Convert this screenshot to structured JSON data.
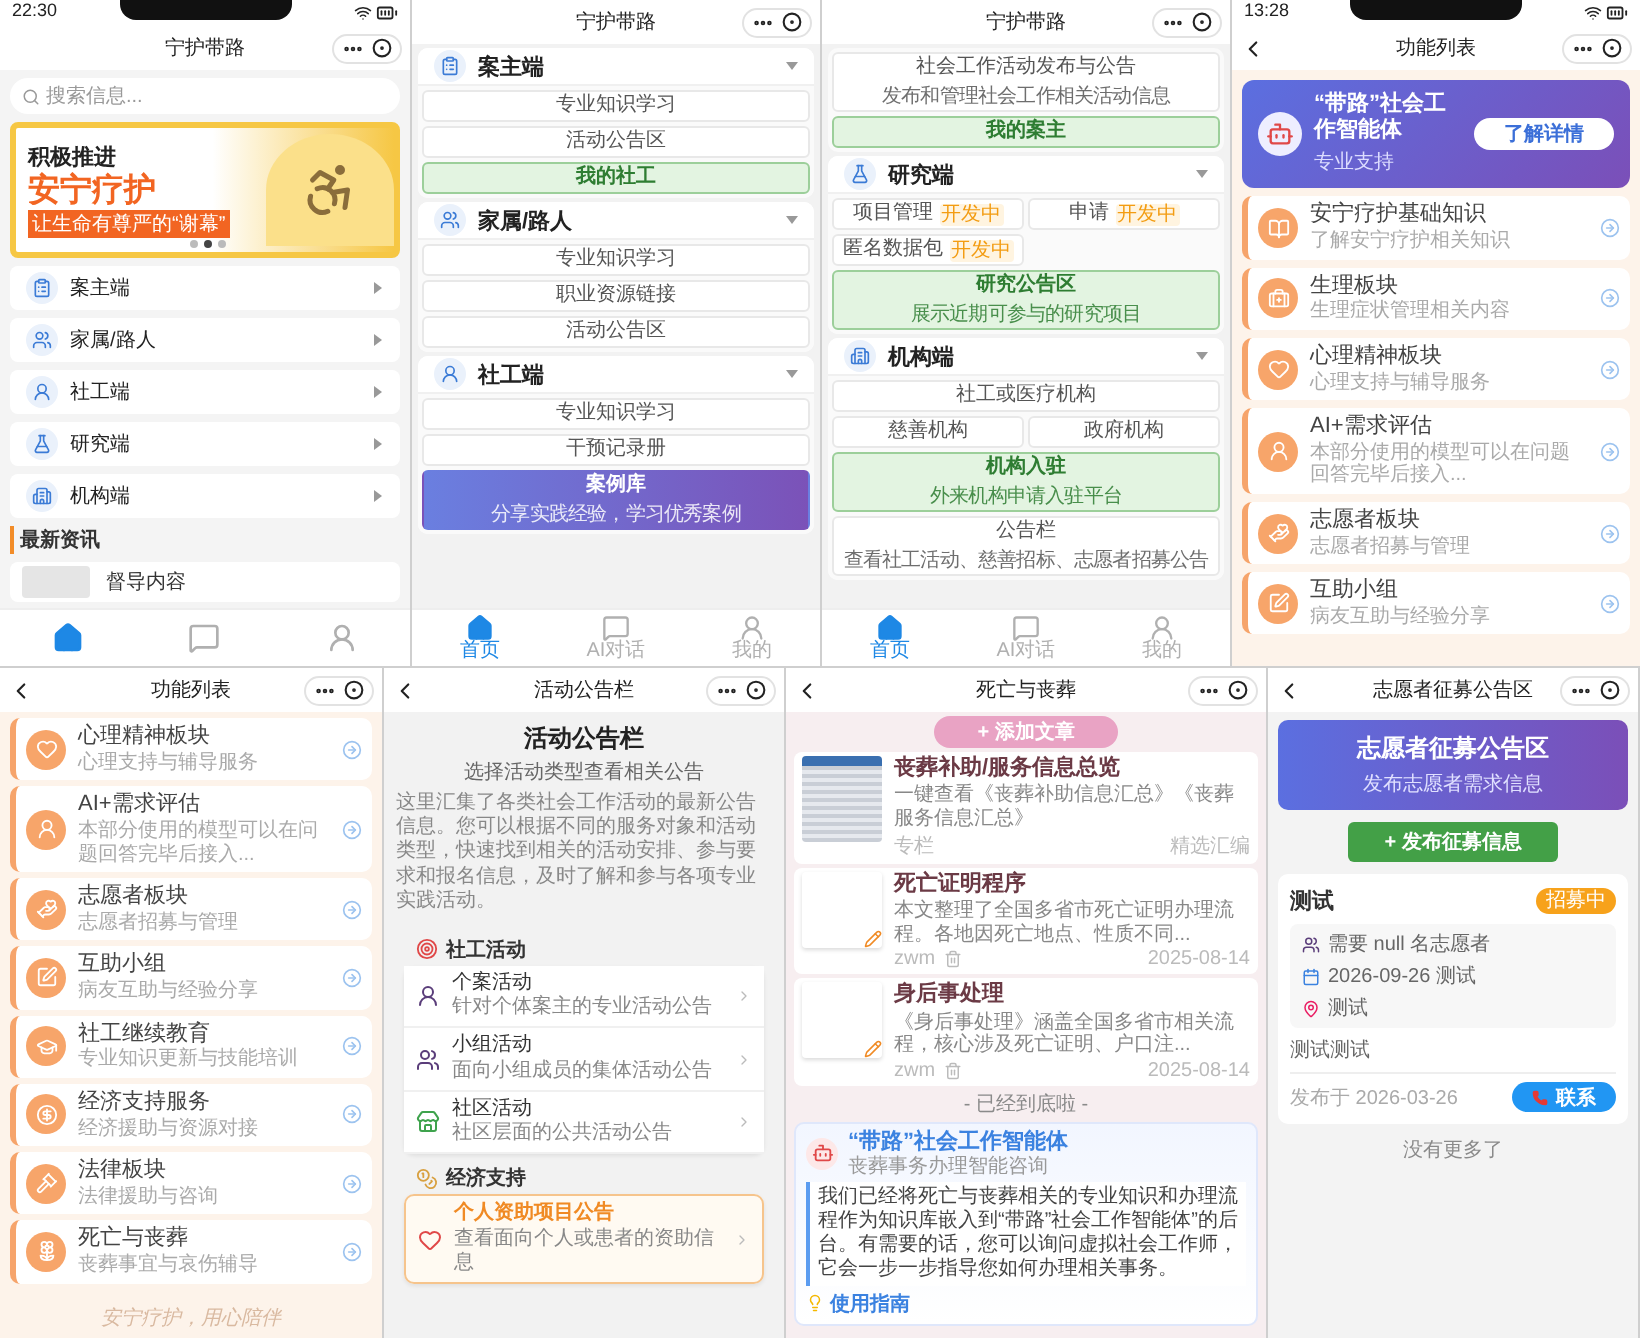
{
  "home": {
    "status_time": "22:30",
    "title": "宁护带路",
    "search": {
      "placeholder": "搜索信息..."
    },
    "banner": {
      "headline": "积极推进",
      "title": "安宁疗护",
      "slogan": "让生命有尊严的“谢幕”",
      "dots": [
        {
          "selected": false
        },
        {
          "selected": true
        },
        {
          "selected": false
        }
      ]
    },
    "roles": [
      {
        "label": "案主端",
        "expanded": false
      },
      {
        "label": "家属/路人",
        "expanded": false
      },
      {
        "label": "社工端",
        "expanded": false
      },
      {
        "label": "研究端",
        "expanded": false
      },
      {
        "label": "机构端",
        "expanded": false
      }
    ],
    "news": {
      "heading": "最新资讯",
      "items": [
        {
          "title": "督导内容"
        }
      ]
    },
    "tabs": [
      {
        "selected": true
      },
      {
        "selected": false
      },
      {
        "selected": false
      }
    ]
  },
  "roles_screen": {
    "title": "宁护带路",
    "sections": [
      {
        "label": "案主端",
        "expanded": true,
        "items": [
          {
            "label": "专业知识学习",
            "kind": "full",
            "selected": false
          },
          {
            "label": "活动公告区",
            "kind": "full",
            "selected": false
          },
          {
            "label": "我的社工",
            "kind": "full",
            "selected": true
          }
        ]
      },
      {
        "label": "家属/路人",
        "expanded": true,
        "items": [
          {
            "label": "专业知识学习",
            "kind": "full",
            "selected": false
          },
          {
            "label": "职业资源链接",
            "kind": "full",
            "selected": false
          },
          {
            "label": "活动公告区",
            "kind": "full",
            "selected": false
          }
        ]
      },
      {
        "label": "社工端",
        "expanded": true,
        "items": [
          {
            "label": "专业知识学习",
            "kind": "full",
            "selected": false
          },
          {
            "label": "干预记录册",
            "kind": "full",
            "selected": false
          },
          {
            "label": "案例库",
            "sub": "分享实践经验，学习优秀案例",
            "kind": "feature",
            "selected": false
          }
        ]
      }
    ],
    "tabs": [
      {
        "label": "首页",
        "selected": true
      },
      {
        "label": "AI对话",
        "selected": false
      },
      {
        "label": "我的",
        "selected": false
      }
    ]
  },
  "institution_screen": {
    "title": "宁护带路",
    "sections": [
      {
        "items": [
          {
            "label": "社会工作活动发布与公告",
            "sub": "发布和管理社会工作相关活动信息",
            "kind": "full",
            "selected": false
          },
          {
            "label": "我的案主",
            "kind": "full",
            "selected": true
          }
        ]
      },
      {
        "label": "研究端",
        "expanded": true,
        "items": [
          {
            "label": "项目管理",
            "badge": "开发中",
            "kind": "half",
            "selected": false
          },
          {
            "label": "申请",
            "badge": "开发中",
            "kind": "half",
            "selected": false
          },
          {
            "label": "匿名数据包",
            "badge": "开发中",
            "kind": "half",
            "selected": false
          },
          {
            "label": "研究公告区",
            "sub": "展示近期可参与的研究项目",
            "kind": "full",
            "selected": true
          }
        ]
      },
      {
        "label": "机构端",
        "expanded": true,
        "items": [
          {
            "label": "社工或医疗机构",
            "kind": "full",
            "selected": false
          },
          {
            "label": "慈善机构",
            "kind": "half",
            "selected": false
          },
          {
            "label": "政府机构",
            "kind": "half",
            "selected": false
          },
          {
            "label": "机构入驻",
            "sub": "外来机构申请入驻平台",
            "kind": "full",
            "selected": true
          },
          {
            "label": "公告栏",
            "sub": "查看社工活动、慈善招标、志愿者招募公告",
            "kind": "full",
            "selected": false
          }
        ]
      }
    ],
    "tabs": [
      {
        "label": "首页",
        "selected": true
      },
      {
        "label": "AI对话",
        "selected": false
      },
      {
        "label": "我的",
        "selected": false
      }
    ]
  },
  "function_list": {
    "status_time": "13:28",
    "title": "功能列表",
    "hero": {
      "title": "“带路”社会工作智能体",
      "subtitle": "专业支持",
      "button": "了解详情"
    },
    "modules": [
      {
        "title": "安宁疗护基础知识",
        "desc": "了解安宁疗护相关知识"
      },
      {
        "title": "生理板块",
        "desc": "生理症状管理相关内容"
      },
      {
        "title": "心理精神板块",
        "desc": "心理支持与辅导服务"
      },
      {
        "title": "AI+需求评估",
        "desc": "本部分使用的模型可以在问题回答完毕后接入..."
      },
      {
        "title": "志愿者板块",
        "desc": "志愿者招募与管理"
      },
      {
        "title": "互助小组",
        "desc": "病友互助与经验分享"
      }
    ]
  },
  "function_list_scrolled": {
    "title": "功能列表",
    "modules": [
      {
        "title": "心理精神板块",
        "desc": "心理支持与辅导服务"
      },
      {
        "title": "AI+需求评估",
        "desc": "本部分使用的模型可以在问题回答完毕后接入..."
      },
      {
        "title": "志愿者板块",
        "desc": "志愿者招募与管理"
      },
      {
        "title": "互助小组",
        "desc": "病友互助与经验分享"
      },
      {
        "title": "社工继续教育",
        "desc": "专业知识更新与技能培训"
      },
      {
        "title": "经济支持服务",
        "desc": "经济援助与资源对接"
      },
      {
        "title": "法律板块",
        "desc": "法律援助与咨询"
      },
      {
        "title": "死亡与丧葬",
        "desc": "丧葬事宜与哀伤辅导"
      }
    ],
    "footer": "安宁疗护，用心陪伴"
  },
  "activity_board": {
    "title": "活动公告栏",
    "heading": "活动公告栏",
    "subheading": "选择活动类型查看相关公告",
    "intro": "这里汇集了各类社会工作活动的最新公告信息。您可以根据不同的服务对象和活动类型，快速找到相关的活动安排、参与要求和报名信息，及时了解和参与各项专业实践活动。",
    "groups": [
      {
        "heading": "社工活动",
        "items": [
          {
            "title": "个案活动",
            "desc": "针对个体案主的专业活动公告",
            "kind": "plain"
          },
          {
            "title": "小组活动",
            "desc": "面向小组成员的集体活动公告",
            "kind": "plain"
          },
          {
            "title": "社区活动",
            "desc": "社区层面的公共活动公告",
            "kind": "plain"
          }
        ]
      },
      {
        "heading": "经济支持",
        "items": [
          {
            "title": "个人资助项目公告",
            "desc": "查看面向个人或患者的资助信息",
            "kind": "featured"
          }
        ]
      }
    ]
  },
  "funeral": {
    "title": "死亡与丧葬",
    "add_button": "+ 添加文章",
    "articles": [
      {
        "title": "丧葬补助/服务信息总览",
        "summary": "一键查看《丧葬补助信息汇总》《丧葬服务信息汇总》",
        "author": "专栏",
        "meta": "精选汇编",
        "kind": "photo",
        "deletable": false
      },
      {
        "title": "死亡证明程序",
        "summary": "本文整理了全国多省市死亡证明办理流程。各地因死亡地点、性质不同...",
        "author": "zwm",
        "meta": "2025-08-14",
        "kind": "editable",
        "deletable": true
      },
      {
        "title": "身后事处理",
        "summary": "《身后事处理》涵盖全国多省市相关流程，核心涉及死亡证明、户口注...",
        "author": "zwm",
        "meta": "2025-08-14",
        "kind": "editable",
        "deletable": true
      }
    ],
    "end_note": "- 已经到底啦 -",
    "assistant": {
      "title": "“带路”社会工作智能体",
      "subtitle": "丧葬事务办理智能咨询",
      "body": "我们已经将死亡与丧葬相关的专业知识和办理流程作为知识库嵌入到“带路”社会工作智能体”的后台。有需要的话，您可以询问虚拟社会工作师，它会一步一步指导您如何办理相关事务。",
      "guide": "使用指南"
    }
  },
  "volunteer": {
    "title": "志愿者征募公告区",
    "banner": {
      "title": "志愿者征募公告区",
      "subtitle": "发布志愿者需求信息"
    },
    "publish_button": "+ 发布征募信息",
    "posts": [
      {
        "title": "测试",
        "status": "招募中",
        "need": "需要 null 名志愿者",
        "schedule": "2026-09-26 测试",
        "place": "测试",
        "body": "测试测试",
        "published": "发布于 2026-03-26",
        "contact": "联系"
      }
    ],
    "end_note": "没有更多了"
  }
}
